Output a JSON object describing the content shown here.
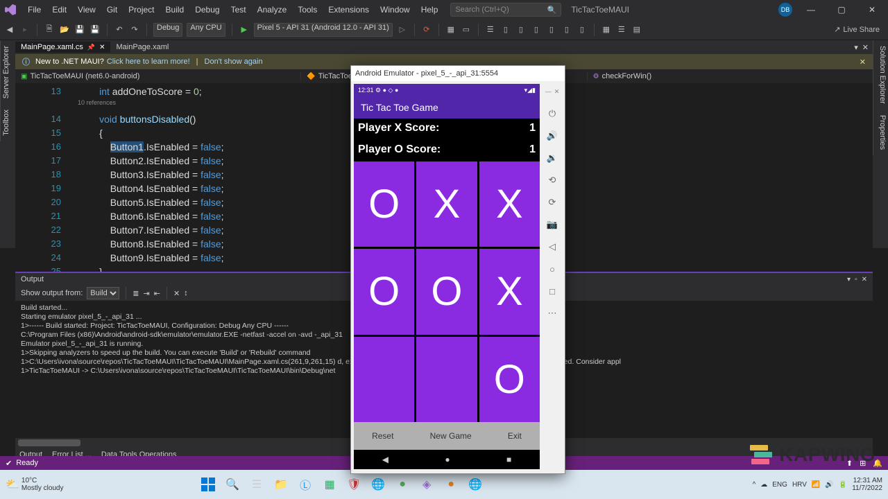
{
  "menu": {
    "items": [
      "File",
      "Edit",
      "View",
      "Git",
      "Project",
      "Build",
      "Debug",
      "Test",
      "Analyze",
      "Tools",
      "Extensions",
      "Window",
      "Help"
    ],
    "search": "Search (Ctrl+Q)",
    "title": "TicTacToeMAUI",
    "avatar": "DB"
  },
  "toolbar": {
    "config": "Debug",
    "platform": "Any CPU",
    "target": "Pixel 5 - API 31 (Android 12.0 - API 31)",
    "liveshare": "Live Share"
  },
  "sidetabs": {
    "left": [
      "Server Explorer",
      "Toolbox"
    ],
    "right": [
      "Solution Explorer",
      "Properties"
    ]
  },
  "doctabs": [
    {
      "label": "MainPage.xaml.cs",
      "active": true,
      "pinned": true
    },
    {
      "label": "MainPage.xaml",
      "active": false
    }
  ],
  "infobar": {
    "text": "New to .NET MAUI?",
    "link": "Click here to learn more!",
    "dismiss": "Don't show again"
  },
  "nav": {
    "a": "TicTacToeMAUI (net6.0-android)",
    "b": "TicTacToeMAUI",
    "c": "checkForWin()"
  },
  "code": {
    "lines": [
      {
        "n": 13,
        "ind": 2,
        "t": [
          {
            "c": "kw-blue",
            "v": "int"
          },
          {
            "v": " addOneToScore = "
          },
          {
            "c": "num",
            "v": "0"
          },
          {
            "v": ";"
          }
        ]
      },
      {
        "n": "",
        "ind": 2,
        "refs": "10 references"
      },
      {
        "n": 14,
        "ind": 2,
        "t": [
          {
            "c": "kw-blue",
            "v": "void"
          },
          {
            "v": " "
          },
          {
            "c": "id",
            "v": "buttonsDisabled"
          },
          {
            "v": "()"
          }
        ]
      },
      {
        "n": 15,
        "ind": 2,
        "t": [
          {
            "v": "{"
          }
        ]
      },
      {
        "n": 16,
        "ind": 3,
        "t": [
          {
            "c": "sel",
            "v": "Button1"
          },
          {
            "v": ".IsEnabled = "
          },
          {
            "c": "kw-blue",
            "v": "false"
          },
          {
            "v": ";"
          }
        ]
      },
      {
        "n": 17,
        "ind": 3,
        "t": [
          {
            "v": "Button2.IsEnabled = "
          },
          {
            "c": "kw-blue",
            "v": "false"
          },
          {
            "v": ";"
          }
        ]
      },
      {
        "n": 18,
        "ind": 3,
        "t": [
          {
            "v": "Button3.IsEnabled = "
          },
          {
            "c": "kw-blue",
            "v": "false"
          },
          {
            "v": ";"
          }
        ]
      },
      {
        "n": 19,
        "ind": 3,
        "t": [
          {
            "v": "Button4.IsEnabled = "
          },
          {
            "c": "kw-blue",
            "v": "false"
          },
          {
            "v": ";"
          }
        ]
      },
      {
        "n": 20,
        "ind": 3,
        "t": [
          {
            "v": "Button5.IsEnabled = "
          },
          {
            "c": "kw-blue",
            "v": "false"
          },
          {
            "v": ";"
          }
        ]
      },
      {
        "n": 21,
        "ind": 3,
        "t": [
          {
            "v": "Button6.IsEnabled = "
          },
          {
            "c": "kw-blue",
            "v": "false"
          },
          {
            "v": ";"
          }
        ]
      },
      {
        "n": 22,
        "ind": 3,
        "t": [
          {
            "v": "Button7.IsEnabled = "
          },
          {
            "c": "kw-blue",
            "v": "false"
          },
          {
            "v": ";"
          }
        ]
      },
      {
        "n": 23,
        "ind": 3,
        "t": [
          {
            "v": "Button8.IsEnabled = "
          },
          {
            "c": "kw-blue",
            "v": "false"
          },
          {
            "v": ";"
          }
        ]
      },
      {
        "n": 24,
        "ind": 3,
        "t": [
          {
            "v": "Button9.IsEnabled = "
          },
          {
            "c": "kw-blue",
            "v": "false"
          },
          {
            "v": ";"
          }
        ]
      },
      {
        "n": 25,
        "ind": 2,
        "t": [
          {
            "v": "}"
          }
        ]
      }
    ]
  },
  "output": {
    "title": "Output",
    "from": "Show output from:",
    "build": "Build",
    "lines": [
      "Build started...",
      "Starting emulator pixel_5_-_api_31 ...",
      "1>------ Build started: Project: TicTacToeMAUI, Configuration: Debug Any CPU ------",
      "C:\\Program Files (x86)\\Android\\android-sdk\\emulator\\emulator.EXE -netfast -accel on -avd                                     -_api_31",
      "Emulator pixel_5_-_api_31 is running.",
      "1>Skipping analyzers to speed up the build. You can execute 'Build' or 'Rebuild' command",
      "1>C:\\Users\\ivona\\source\\repos\\TicTacToeMAUI\\TicTacToeMAUI\\MainPage.xaml.cs(261,9,261,15)                                  d, execution of the current method continues before the call is completed. Consider appl",
      "1>TicTacToeMAUI -> C:\\Users\\ivona\\source\\repos\\TicTacToeMAUI\\TicTacToeMAUI\\bin\\Debug\\net"
    ]
  },
  "bottomtabs": [
    "Output",
    "Error List ...",
    "Data Tools Operations"
  ],
  "status": {
    "ready": "Ready"
  },
  "taskbar": {
    "temp": "10°C",
    "weather": "Mostly cloudy",
    "time": "12:31 AM",
    "date": "11/7/2022",
    "lang": "ENG",
    "kb": "HRV"
  },
  "emulator": {
    "title": "Android Emulator - pixel_5_-_api_31:5554",
    "time": "12:31",
    "app": "Tic Tac Toe Game",
    "px": "Player X Score:",
    "po": "Player O Score:",
    "sx": "1",
    "so": "1",
    "cells": [
      "O",
      "X",
      "X",
      "O",
      "O",
      "X",
      "",
      "",
      "O"
    ],
    "reset": "Reset",
    "newgame": "New Game",
    "exit": "Exit"
  },
  "watermark": "KAPWING"
}
